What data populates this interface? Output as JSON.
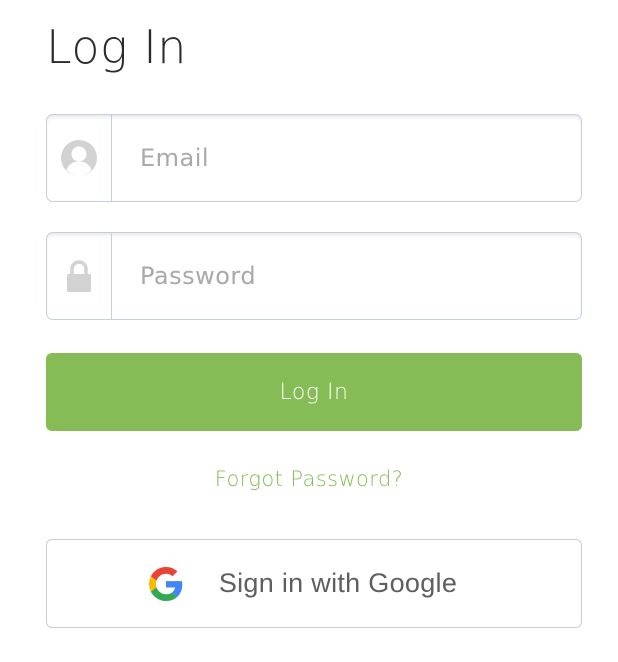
{
  "page": {
    "title": "Log In"
  },
  "email_field": {
    "placeholder": "Email",
    "value": "",
    "icon": "user-silhouette-icon"
  },
  "password_field": {
    "placeholder": "Password",
    "value": "",
    "icon": "lock-icon"
  },
  "login_button": {
    "label": "Log In",
    "color": "#86bc55"
  },
  "forgot_link": {
    "label": "Forgot Password?",
    "color": "#86bc55"
  },
  "google_button": {
    "label": "Sign in with Google",
    "icon": "google-g-icon"
  }
}
